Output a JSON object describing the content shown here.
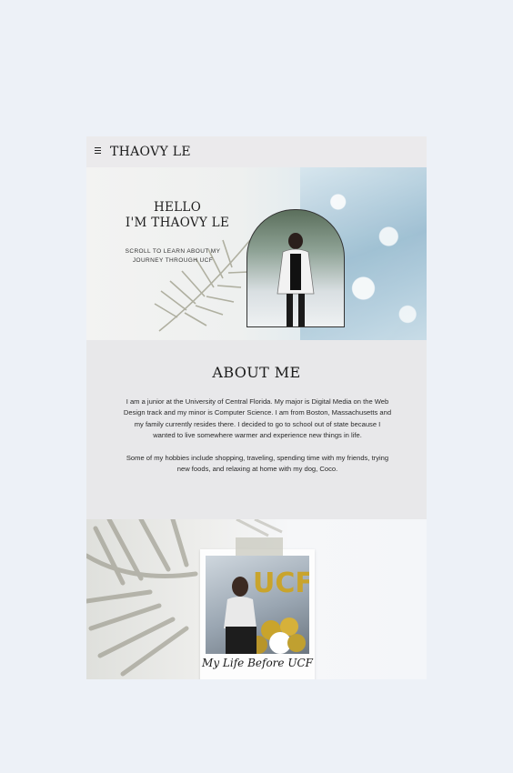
{
  "header": {
    "site_title": "THAOVY LE",
    "menu_icon": "hamburger-menu-icon"
  },
  "hero": {
    "greeting_line1": "HELLO",
    "greeting_line2": "I'M THAOVY LE",
    "subtitle_line1": "SCROLL TO LEARN ABOUT MY",
    "subtitle_line2": "JOURNEY THROUGH UCF"
  },
  "about": {
    "title": "ABOUT ME",
    "paragraph1": "I am a junior at the University of Central Florida. My major is Digital Media on the Web Design track and my minor is Computer Science. I am from Boston, Massachusetts and my family currently resides there. I decided to go to school out of state because I wanted to live somewhere warmer and experience new things in life.",
    "paragraph2": "Some of my hobbies include shopping, traveling, spending time with my friends, trying new foods, and relaxing at home with my dog, Coco."
  },
  "polaroid": {
    "caption": "My Life Before UCF",
    "balloon_text": "UCF"
  },
  "colors": {
    "page_background": "#edf1f7",
    "section_background": "#e8e8ea",
    "text": "#1b1b1b"
  }
}
